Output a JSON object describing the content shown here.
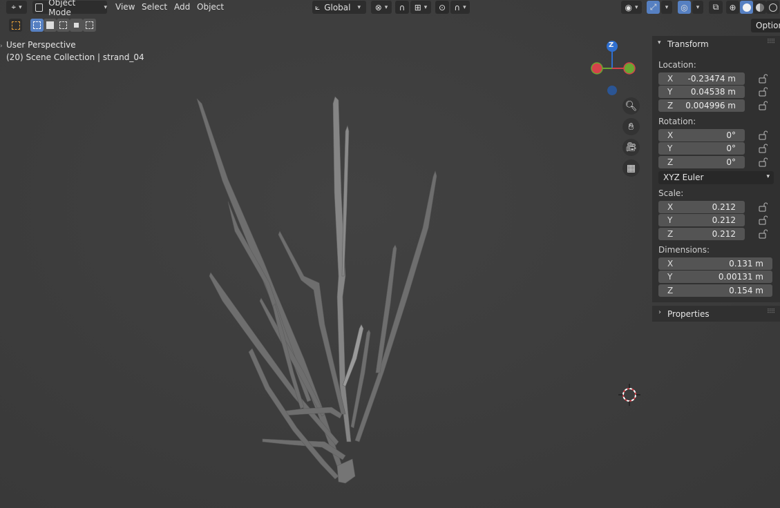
{
  "header": {
    "mode": "Object Mode",
    "menus": [
      "View",
      "Select",
      "Add",
      "Object"
    ],
    "orientation": "Global"
  },
  "viewport": {
    "perspective_label": "User Perspective",
    "collection_label": "(20) Scene Collection | strand_04",
    "gizmo_axis_z": "Z"
  },
  "options_tab": "Options",
  "transform": {
    "title": "Transform",
    "location_label": "Location:",
    "location": [
      {
        "axis": "X",
        "value": "-0.23474 m"
      },
      {
        "axis": "Y",
        "value": "0.04538 m"
      },
      {
        "axis": "Z",
        "value": "0.004996 m"
      }
    ],
    "rotation_label": "Rotation:",
    "rotation": [
      {
        "axis": "X",
        "value": "0°"
      },
      {
        "axis": "Y",
        "value": "0°"
      },
      {
        "axis": "Z",
        "value": "0°"
      }
    ],
    "rotation_mode": "XYZ Euler",
    "scale_label": "Scale:",
    "scale": [
      {
        "axis": "X",
        "value": "0.212"
      },
      {
        "axis": "Y",
        "value": "0.212"
      },
      {
        "axis": "Z",
        "value": "0.212"
      }
    ],
    "dimensions_label": "Dimensions:",
    "dimensions": [
      {
        "axis": "X",
        "value": "0.131 m"
      },
      {
        "axis": "Y",
        "value": "0.00131 m"
      },
      {
        "axis": "Z",
        "value": "0.154 m"
      }
    ]
  },
  "properties": {
    "title": "Properties"
  },
  "colors": {
    "accent": "#5680c2",
    "gizmo_x": "#d4424a",
    "gizmo_y": "#6aa632",
    "gizmo_z": "#2f6fcf"
  }
}
